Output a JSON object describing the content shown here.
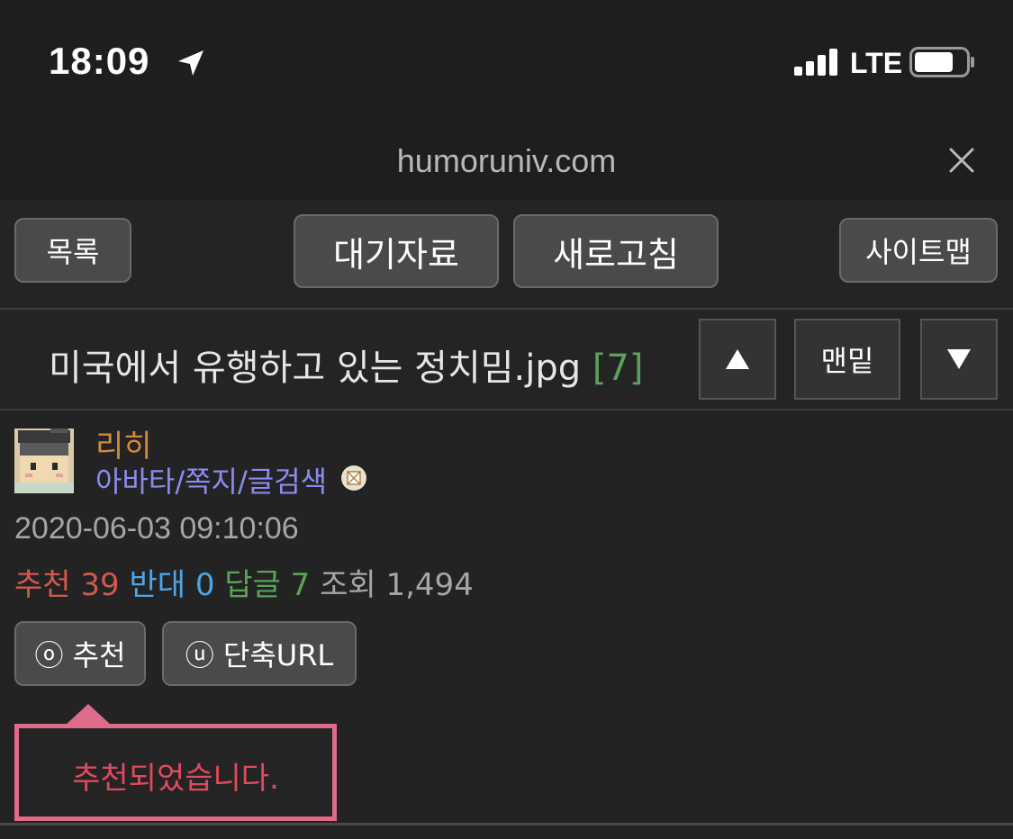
{
  "status_bar": {
    "time": "18:09",
    "network": "LTE",
    "icons": [
      "location-arrow-icon",
      "signal-icon",
      "battery-icon"
    ]
  },
  "browser": {
    "url": "humoruniv.com",
    "close_icon": "close-icon"
  },
  "toolbar": {
    "list_label": "목록",
    "pending_label": "대기자료",
    "refresh_label": "새로고침",
    "sitemap_label": "사이트맵"
  },
  "post": {
    "title": "미국에서 유행하고 있는 정치밈.jpg",
    "comment_count": "[7]",
    "up_icon": "up-triangle-icon",
    "bottom_label": "맨밑",
    "down_icon": "down-triangle-icon",
    "author": "리히",
    "author_links": "아바타/쪽지/글검색",
    "date": "2020-06-03 09:10:06",
    "stats": {
      "recommend_label": "추천",
      "recommend_value": "39",
      "oppose_label": "반대",
      "oppose_value": "0",
      "reply_label": "답글",
      "reply_value": "7",
      "views_label": "조회",
      "views_value": "1,494"
    },
    "recommend_button": "ⓞ 추천",
    "short_url_button": "ⓤ 단축URL",
    "toast": "추천되었습니다."
  },
  "colors": {
    "background": "#1f1f1f",
    "author": "#d08a3c",
    "links": "#8b8bf0",
    "recommend": "#d05a4a",
    "oppose": "#4ea6e6",
    "reply": "#5aa35a",
    "toast_border": "#e06a8a"
  }
}
